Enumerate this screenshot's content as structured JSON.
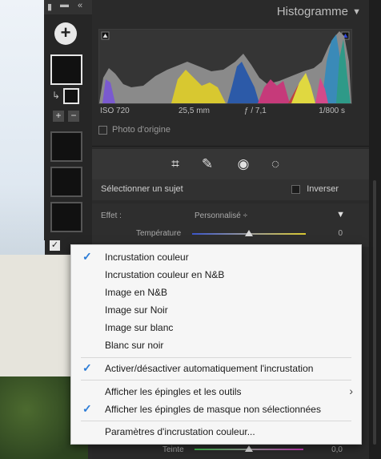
{
  "panel": {
    "title": "Histogramme",
    "collapse_icon": "triangle-down-icon"
  },
  "histogram": {
    "iso": "ISO 720",
    "focal": "25,5 mm",
    "aperture": "ƒ / 7,1",
    "shutter": "1/800 s",
    "original_label": "Photo d'origine"
  },
  "mask_tools": {
    "icons": [
      "crop-icon",
      "heal-icon",
      "redeye-icon",
      "mask-icon"
    ]
  },
  "subject": {
    "label": "Sélectionner un sujet",
    "invert_label": "Inverser"
  },
  "effect": {
    "label": "Effet :",
    "preset": "Personnalisé ÷",
    "temp_label": "Température",
    "temp_value": "0"
  },
  "tint": {
    "label": "Teinte",
    "value": "0,0"
  },
  "menu": {
    "items": [
      {
        "label": "Incrustation couleur",
        "checked": true
      },
      {
        "label": "Incrustation couleur en N&B",
        "checked": false
      },
      {
        "label": "Image en N&B",
        "checked": false
      },
      {
        "label": "Image sur Noir",
        "checked": false
      },
      {
        "label": "Image sur blanc",
        "checked": false
      },
      {
        "label": "Blanc sur noir",
        "checked": false
      },
      {
        "label": "Activer/désactiver automatiquement l'incrustation",
        "checked": true
      },
      {
        "label": "Afficher les épingles et les outils",
        "checked": false,
        "submenu": true
      },
      {
        "label": "Afficher les épingles de masque non sélectionnées",
        "checked": true
      },
      {
        "label": "Paramètres d'incrustation couleur...",
        "checked": false
      }
    ]
  },
  "colors": {
    "menu_check": "#2b7bd6",
    "panel_bg": "#2a2a2a"
  }
}
